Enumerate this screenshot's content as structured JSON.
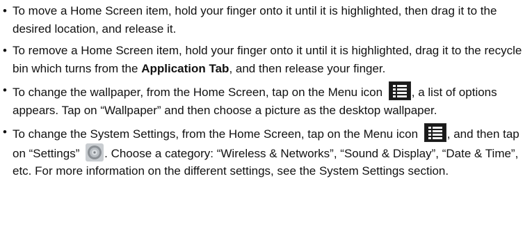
{
  "bullet_char": "•",
  "items": [
    {
      "text": "To move a Home Screen item, hold your finger onto it until it is highlighted, then drag it to the desired location, and release it."
    },
    {
      "text_before": "To remove a Home Screen item, hold your finger onto it until it is highlighted, drag it to the recycle bin which turns from the ",
      "bold": "Application Tab",
      "text_after": ", and then release your finger."
    },
    {
      "text_before": "To change the wallpaper, from the Home Screen, tap on the Menu icon",
      "icon": "menu-icon",
      "text_after": ", a list of options appears. Tap on “Wallpaper” and then choose a picture as the desktop wallpaper."
    },
    {
      "text_before": "To change the System Settings, from the Home Screen, tap on the Menu icon",
      "icon1": "menu-icon",
      "text_mid": ", and then tap on “Settings”",
      "icon2": "settings-icon",
      "text_after": ". Choose a category: “Wireless & Networks”, “Sound & Display”, “Date & Time”, etc. For more information on the different settings, see the System Settings section."
    }
  ],
  "colors": {
    "text": "#111111",
    "menu_icon_bg": "#2a2a2a",
    "menu_icon_lines": "#f5f5f5",
    "settings_icon_ring": "#8a8f94",
    "settings_icon_center": "#d9dde0"
  }
}
